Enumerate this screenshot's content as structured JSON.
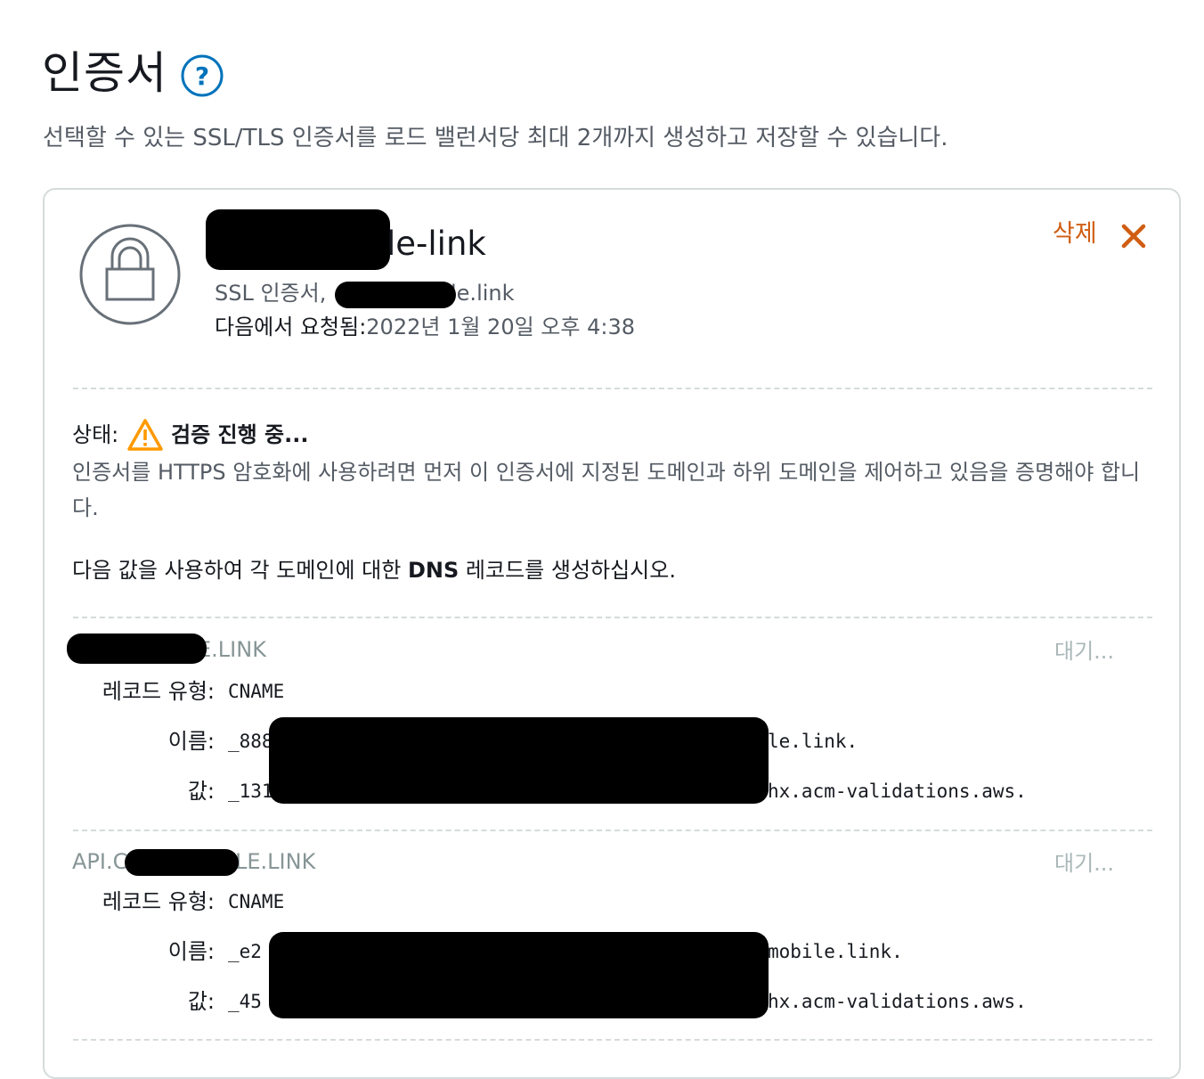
{
  "header": {
    "title": "인증서",
    "subtitle": "선택할 수 있는 SSL/TLS 인증서를 로드 밸런서당 최대 2개까지 생성하고 저장할 수 있습니다."
  },
  "certificate": {
    "name_visible": "le-link",
    "type_prefix": "SSL 인증서,",
    "type_suffix": "le.link",
    "requested_label": "다음에서 요청됨:",
    "requested_value": "2022년 1월 20일 오후 4:38",
    "delete_label": "삭제",
    "status_label": "상태:",
    "status_text": "검증 진행 중...",
    "status_description": "인증서를 HTTPS 암호화에 사용하려면 먼저 이 인증서에 지정된 도메인과 하위 도메인을 제어하고 있음을 증명해야 합니다.",
    "instruction_pre": "다음 값을 사용하여 각 도메인에 대한 ",
    "instruction_bold": "DNS",
    "instruction_post": " 레코드를 생성하십시오."
  },
  "records": [
    {
      "domain_visible": "E.LINK",
      "status": "대기...",
      "type_label": "레코드 유형:",
      "type_value": "CNAME",
      "name_label": "이름:",
      "name_prefix": "_888",
      "name_suffix": "le.link.",
      "value_label": "값:",
      "value_prefix": "_131",
      "value_suffix": "hx.acm-validations.aws."
    },
    {
      "domain_prefix": "API.C",
      "domain_visible": "LE.LINK",
      "status": "대기...",
      "type_label": "레코드 유형:",
      "type_value": "CNAME",
      "name_label": "이름:",
      "name_prefix": "_e2",
      "name_suffix": "mobile.link.",
      "value_label": "값:",
      "value_prefix": "_45",
      "value_suffix": "hx.acm-validations.aws."
    }
  ],
  "colors": {
    "accent": "#d05d12",
    "help_icon": "#0073bb",
    "warning": "#ff9900",
    "muted_text": "#545b64",
    "pending_text": "#aab7b8"
  },
  "icons": {
    "help": "question-circle-icon",
    "certificate": "lock-icon",
    "delete": "close-icon",
    "status": "warning-icon"
  }
}
